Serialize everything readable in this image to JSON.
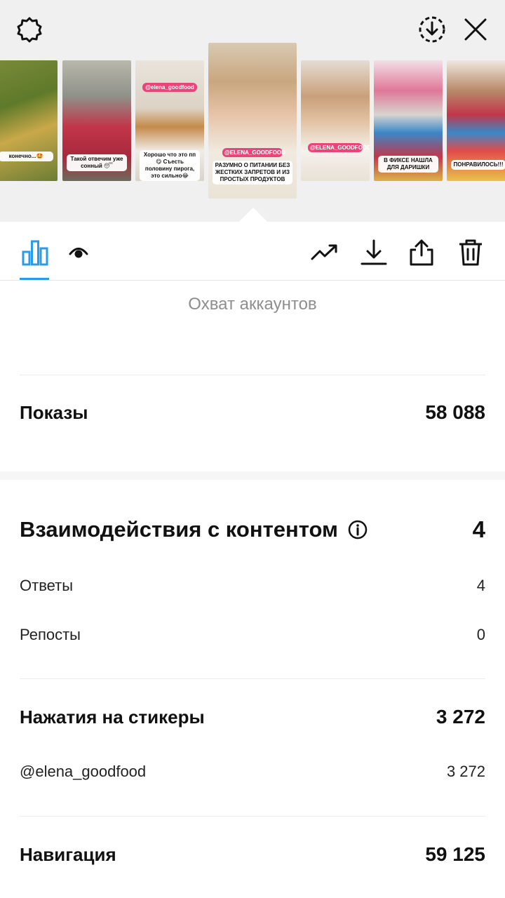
{
  "top_bar": {
    "settings_icon": "gear-icon",
    "save_icon": "download-circle-icon",
    "close_icon": "close-icon"
  },
  "stories": [
    {
      "caption": "конечно...🤩",
      "tag": ""
    },
    {
      "caption": "Такой отвечим уже сонный 😴",
      "tag": ""
    },
    {
      "caption": "Хорошо что это пп😋 Съесть половину пирога, это сильно😂",
      "tag": "@elena_goodfood"
    },
    {
      "caption": "РАЗУМНО О ПИТАНИИ БЕЗ ЖЕСТКИХ ЗАПРЕТОВ И ИЗ ПРОСТЫХ ПРОДУКТОВ",
      "tag": "@ELENA_GOODFOOD"
    },
    {
      "caption": "",
      "tag": "@ELENA_GOODFOOD"
    },
    {
      "caption": "В ФИКСЕ НАШЛА ДЛЯ ДАРИШКИ",
      "tag": ""
    },
    {
      "caption": "ПОНРАВИЛОСЬ!!!",
      "tag": ""
    }
  ],
  "tabs": {
    "insights_icon": "bar-chart-icon",
    "viewers_icon": "eye-icon",
    "actions": [
      "trending-up-icon",
      "download-icon",
      "share-icon",
      "trash-icon"
    ],
    "accent_color": "#2a9be8"
  },
  "stats": {
    "reach_label": "Охват аккаунтов",
    "impressions": {
      "label": "Показы",
      "value": "58 088"
    },
    "interactions": {
      "label": "Взаимодействия с контентом",
      "value": "4"
    },
    "replies": {
      "label": "Ответы",
      "value": "4"
    },
    "shares": {
      "label": "Репосты",
      "value": "0"
    },
    "sticker_taps": {
      "label": "Нажатия на стикеры",
      "value": "3 272"
    },
    "sticker_account": {
      "label": "@elena_goodfood",
      "value": "3 272"
    },
    "navigation": {
      "label": "Навигация",
      "value": "59 125"
    }
  }
}
